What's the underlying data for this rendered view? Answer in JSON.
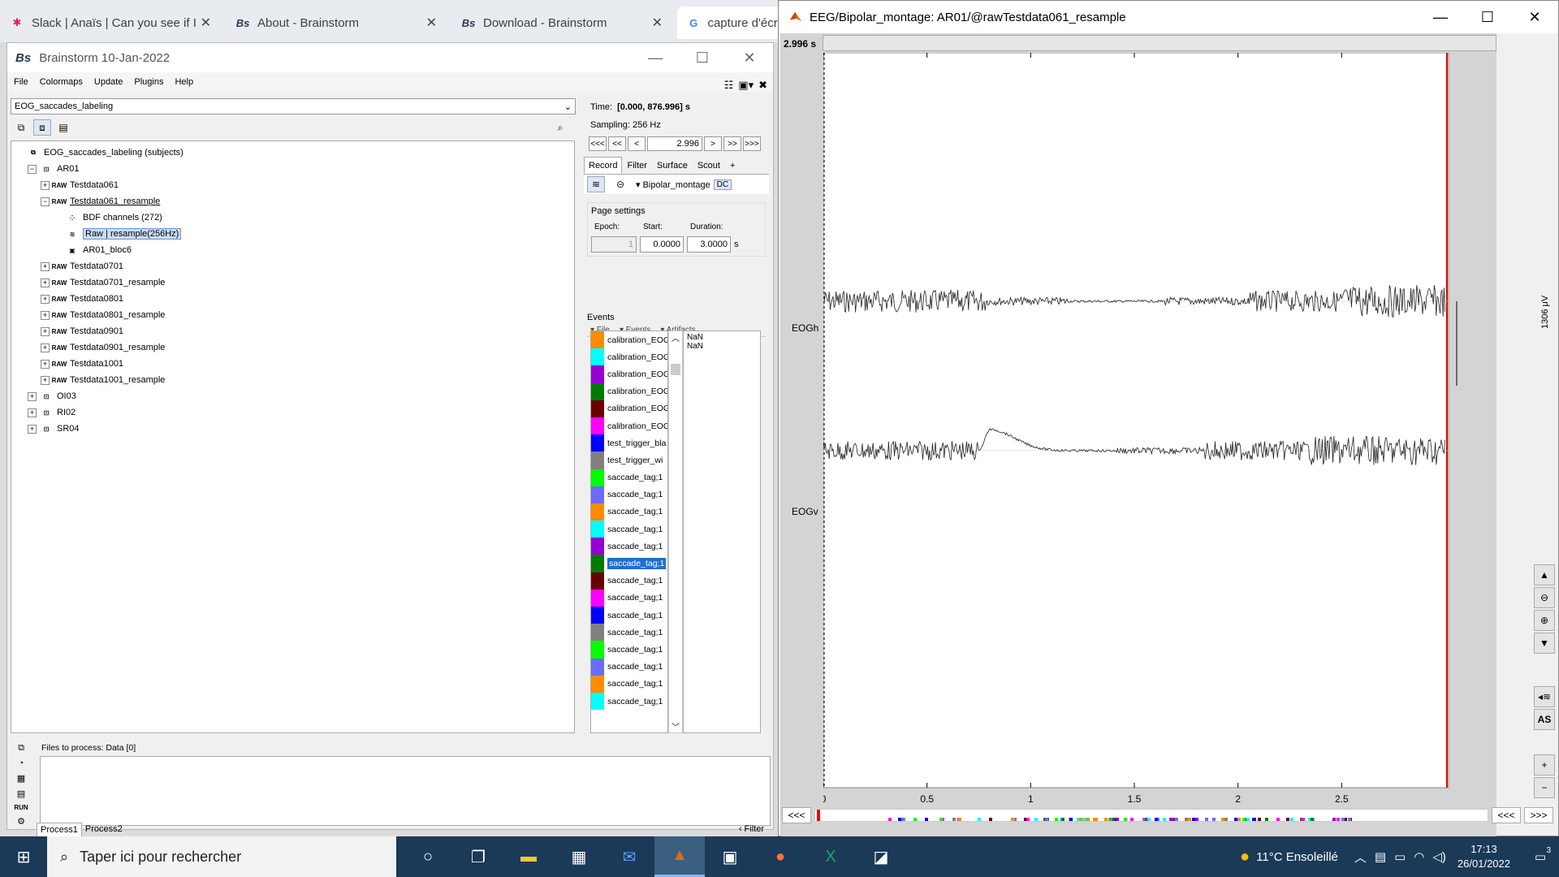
{
  "browser": {
    "tabs": [
      {
        "label": "Slack | Anaïs | Can you see if I",
        "icon": "slack-icon"
      },
      {
        "label": "About - Brainstorm",
        "icon": "brainstorm-icon"
      },
      {
        "label": "Download - Brainstorm",
        "icon": "brainstorm-icon"
      },
      {
        "label": "capture d'écra",
        "icon": "google-icon"
      }
    ]
  },
  "bs": {
    "logo": "Bs",
    "title": "Brainstorm 10-Jan-2022",
    "menu": [
      "File",
      "Colormaps",
      "Update",
      "Plugins",
      "Help"
    ],
    "protocol": "EOG_saccades_labeling",
    "tree": [
      {
        "label": "EOG_saccades_labeling (subjects)",
        "level": 0,
        "icon": "subjects-icon",
        "exp": ""
      },
      {
        "label": "AR01",
        "level": 1,
        "icon": "subject-icon",
        "exp": "−"
      },
      {
        "label": "Testdata061",
        "level": 2,
        "icon": "raw-icon",
        "exp": "+"
      },
      {
        "label": "Testdata061_resample",
        "level": 2,
        "icon": "raw-icon",
        "exp": "−",
        "underline": true
      },
      {
        "label": "BDF channels (272)",
        "level": 3,
        "icon": "channel-icon",
        "exp": ""
      },
      {
        "label": "Raw | resample(256Hz)",
        "level": 3,
        "icon": "rawdata-icon",
        "exp": "",
        "selected": true
      },
      {
        "label": "AR01_bloc6",
        "level": 3,
        "icon": "matrix-icon",
        "exp": ""
      },
      {
        "label": "Testdata0701",
        "level": 2,
        "icon": "raw-icon",
        "exp": "+"
      },
      {
        "label": "Testdata0701_resample",
        "level": 2,
        "icon": "raw-icon",
        "exp": "+"
      },
      {
        "label": "Testdata0801",
        "level": 2,
        "icon": "raw-icon",
        "exp": "+"
      },
      {
        "label": "Testdata0801_resample",
        "level": 2,
        "icon": "raw-icon",
        "exp": "+"
      },
      {
        "label": "Testdata0901",
        "level": 2,
        "icon": "raw-icon",
        "exp": "+"
      },
      {
        "label": "Testdata0901_resample",
        "level": 2,
        "icon": "raw-icon",
        "exp": "+"
      },
      {
        "label": "Testdata1001",
        "level": 2,
        "icon": "raw-icon",
        "exp": "+"
      },
      {
        "label": "Testdata1001_resample",
        "level": 2,
        "icon": "raw-icon",
        "exp": "+"
      },
      {
        "label": "OI03",
        "level": 1,
        "icon": "subject-icon",
        "exp": "+"
      },
      {
        "label": "RI02",
        "level": 1,
        "icon": "subject-icon",
        "exp": "+"
      },
      {
        "label": "SR04",
        "level": 1,
        "icon": "subject-icon",
        "exp": "+"
      }
    ],
    "time_label": "Time:",
    "time_value": "[0.000, 876.996] s",
    "sampling": "Sampling: 256 Hz",
    "nav": {
      "b1": "<<<",
      "b2": "<<",
      "b3": "<",
      "value": "2.996",
      "f1": ">",
      "f2": ">>",
      "f3": ">>>"
    },
    "tabs": [
      "Record",
      "Filter",
      "Surface",
      "Scout",
      "+"
    ],
    "montage": "Bipolar_montage",
    "dc": "DC",
    "page_settings": {
      "title": "Page settings",
      "epoch_label": "Epoch:",
      "start_label": "Start:",
      "duration_label": "Duration:",
      "epoch": "1",
      "start": "0.0000",
      "duration": "3.0000",
      "unit": "s"
    },
    "events": {
      "title": "Events",
      "menu": [
        "File",
        "Events",
        "Artifacts"
      ],
      "times": [
        "NaN",
        "NaN"
      ],
      "items": [
        {
          "label": "calibration_EOG",
          "color": "#ff8c00"
        },
        {
          "label": "calibration_EOG",
          "color": "#00ffff"
        },
        {
          "label": "calibration_EOG",
          "color": "#9400d3"
        },
        {
          "label": "calibration_EOG",
          "color": "#007a00"
        },
        {
          "label": "calibration_EOG",
          "color": "#6b0000"
        },
        {
          "label": "calibration_EOG",
          "color": "#ff00ff"
        },
        {
          "label": "test_trigger_bla",
          "color": "#0000ff"
        },
        {
          "label": "test_trigger_wi",
          "color": "#808080"
        },
        {
          "label": "saccade_tag;1",
          "color": "#00ff00"
        },
        {
          "label": "saccade_tag;1",
          "color": "#6b6bff"
        },
        {
          "label": "saccade_tag;1",
          "color": "#ff8c00"
        },
        {
          "label": "saccade_tag;1",
          "color": "#00ffff"
        },
        {
          "label": "saccade_tag;1",
          "color": "#9400d3"
        },
        {
          "label": "saccade_tag;1",
          "color": "#007a00",
          "selected": true
        },
        {
          "label": "saccade_tag;1",
          "color": "#6b0000"
        },
        {
          "label": "saccade_tag;1",
          "color": "#ff00ff"
        },
        {
          "label": "saccade_tag;1",
          "color": "#0000ff"
        },
        {
          "label": "saccade_tag;1",
          "color": "#808080"
        },
        {
          "label": "saccade_tag;1",
          "color": "#00ff00"
        },
        {
          "label": "saccade_tag;1",
          "color": "#6b6bff"
        },
        {
          "label": "saccade_tag;1",
          "color": "#ff8c00"
        },
        {
          "label": "saccade_tag;1",
          "color": "#00ffff"
        }
      ]
    },
    "process": {
      "label": "Files to process: Data [0]",
      "run": "RUN",
      "tabs": [
        "Process1",
        "Process2"
      ],
      "filter": "Filter"
    }
  },
  "eeg": {
    "title": "EEG/Bipolar_montage: AR01/@rawTestdata061_resample",
    "time": "2.996 s",
    "channels": [
      "EOGh",
      "EOGv"
    ],
    "scale": "1306 μV",
    "x_ticks": [
      "0",
      "0.5",
      "1",
      "1.5",
      "2",
      "2.5"
    ],
    "as_btn": "AS",
    "nav": {
      "left": "<<<",
      "left2": "<<<",
      "right": ">>>"
    }
  },
  "taskbar": {
    "search": "Taper ici pour rechercher",
    "weather": "11°C  Ensoleillé",
    "time": "17:13",
    "date": "26/01/2022",
    "notif": "3"
  }
}
